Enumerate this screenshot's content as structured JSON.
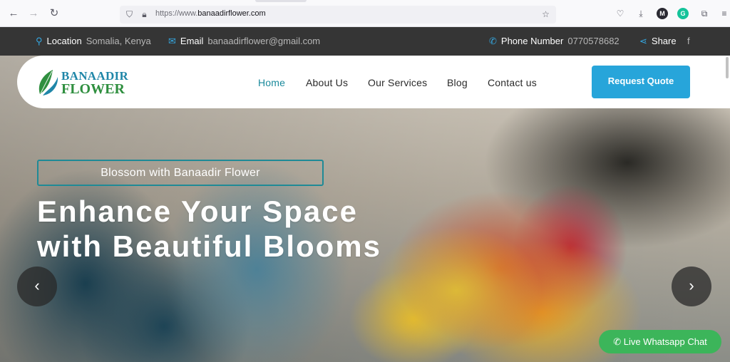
{
  "browser": {
    "url_prefix": "https://www.",
    "url_domain": "banaadirflower.com",
    "icons": [
      "back-icon",
      "forward-icon",
      "reload-icon",
      "shield-icon",
      "lock-icon",
      "star-icon",
      "pocket-icon",
      "download-icon",
      "account-icon",
      "grammarly-icon",
      "extensions-icon",
      "menu-icon"
    ],
    "account_initial": "M",
    "grammarly_initial": "G"
  },
  "topbar": {
    "location_label": "Location",
    "location_value": "Somalia, Kenya",
    "email_label": "Email",
    "email_value": "banaadirflower@gmail.com",
    "phone_label": "Phone Number",
    "phone_value": "0770578682",
    "share_label": "Share",
    "facebook": "f"
  },
  "header": {
    "logo_line1": "BANAADIR",
    "logo_line2": "FLOWER",
    "nav": [
      "Home",
      "About Us",
      "Our Services",
      "Blog",
      "Contact us"
    ],
    "quote_button": "Request Quote"
  },
  "hero": {
    "tagline": "Blossom with Banaadir Flower",
    "title_line1": "Enhance Your Space",
    "title_line2": "with Beautiful Blooms",
    "prev": "‹",
    "next": "›"
  },
  "whatsapp": {
    "label": "Live Whatsapp Chat"
  },
  "colors": {
    "accent": "#27a5da",
    "topbar_bg": "#353535",
    "active_nav": "#1a8a9c",
    "whatsapp": "#3cb55a"
  }
}
